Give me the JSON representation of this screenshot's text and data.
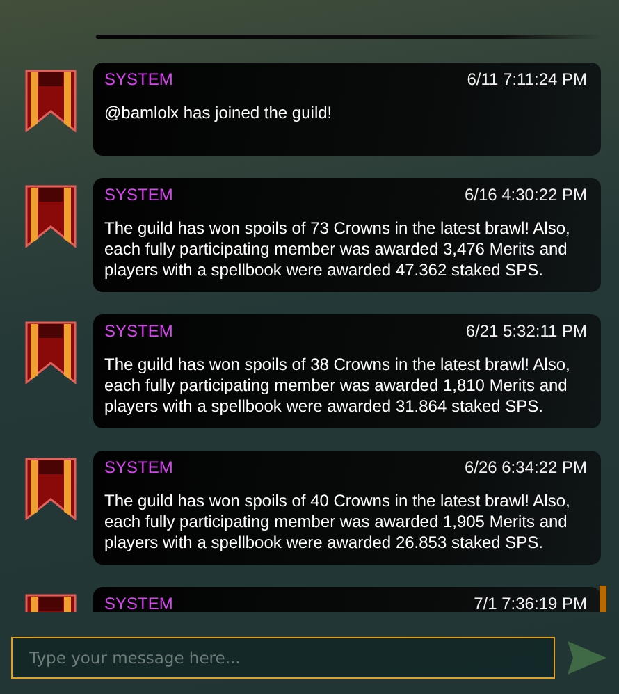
{
  "messages": [
    {
      "sender": "SYSTEM",
      "time": "6/11 7:11:24 PM",
      "text": "@bamlolx has joined the guild!"
    },
    {
      "sender": "SYSTEM",
      "time": "6/16 4:30:22 PM",
      "text": "The guild has won spoils of 73 Crowns in the latest brawl! Also, each fully participating member was awarded 3,476 Merits and players with a spellbook were awarded 47.362 staked SPS."
    },
    {
      "sender": "SYSTEM",
      "time": "6/21 5:32:11 PM",
      "text": "The guild has won spoils of 38 Crowns in the latest brawl! Also, each fully participating member was awarded 1,810 Merits and players with a spellbook were awarded 31.864 staked SPS."
    },
    {
      "sender": "SYSTEM",
      "time": "6/26 6:34:22 PM",
      "text": "The guild has won spoils of 40 Crowns in the latest brawl! Also, each fully participating member was awarded 1,905 Merits and players with a spellbook were awarded 26.853 staked SPS."
    },
    {
      "sender": "SYSTEM",
      "time": "7/1 7:36:19 PM"
    }
  ],
  "composer": {
    "placeholder": "Type your message here..."
  }
}
